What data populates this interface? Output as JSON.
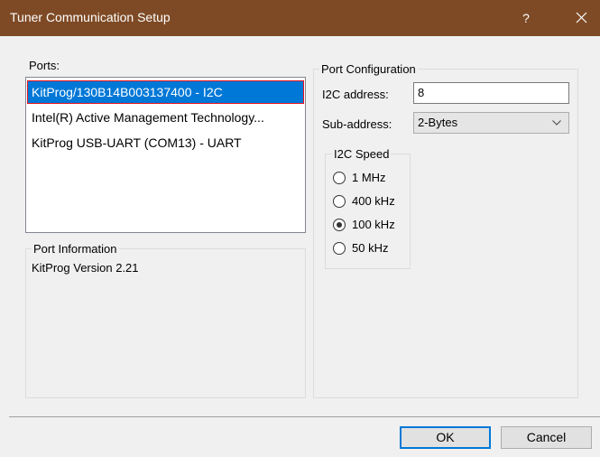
{
  "window": {
    "title": "Tuner Communication Setup",
    "help_glyph": "?"
  },
  "ports": {
    "label": "Ports:",
    "items": [
      {
        "text": "KitProg/130B14B003137400 - I2C",
        "selected": true
      },
      {
        "text": "Intel(R) Active Management Technology..."
      },
      {
        "text": "KitProg USB-UART (COM13) - UART"
      }
    ]
  },
  "port_information": {
    "title": "Port Information",
    "text": "KitProg Version 2.21"
  },
  "port_configuration": {
    "title": "Port Configuration",
    "i2c_address_label": "I2C address:",
    "i2c_address_value": "8",
    "sub_address_label": "Sub-address:",
    "sub_address_value": "2-Bytes",
    "speed": {
      "title": "I2C Speed",
      "options": [
        {
          "label": "1 MHz",
          "checked": false
        },
        {
          "label": "400 kHz",
          "checked": false
        },
        {
          "label": "100 kHz",
          "checked": true
        },
        {
          "label": "50 kHz",
          "checked": false
        }
      ]
    }
  },
  "buttons": {
    "ok": "OK",
    "cancel": "Cancel"
  },
  "colors": {
    "titlebar": "#7e4a25",
    "selection": "#0078d7",
    "highlight_border": "#e8141c"
  }
}
